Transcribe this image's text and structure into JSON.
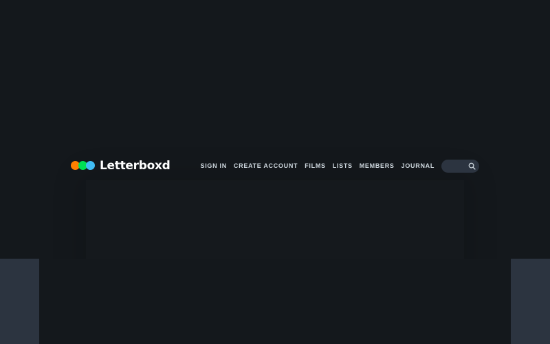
{
  "site": {
    "name": "Letterboxd",
    "brand_colors": {
      "orange": "#ff8000",
      "green": "#00e054",
      "blue": "#40bcf4"
    }
  },
  "header": {
    "nav": [
      {
        "label": "SIGN IN"
      },
      {
        "label": "CREATE ACCOUNT"
      },
      {
        "label": "FILMS"
      },
      {
        "label": "LISTS"
      },
      {
        "label": "MEMBERS"
      },
      {
        "label": "JOURNAL"
      }
    ],
    "search": {
      "value": "",
      "placeholder": "",
      "icon": "search-icon"
    }
  },
  "theme": {
    "background": "#14181c",
    "panel": "#2c3440",
    "nav_text": "#cdd6dd"
  }
}
